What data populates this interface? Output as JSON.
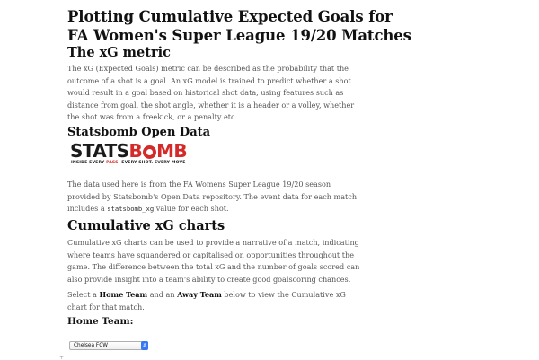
{
  "title": "Plotting Cumulative Expected Goals for FA Women's Super League 19/20 Matches",
  "title_line1": "Plotting Cumulative Expected Goals for",
  "title_line2": "FA Women's Super League 19/20 Matches",
  "sections": {
    "xg": {
      "heading": "The xG metric",
      "paragraph": "The xG (Expected Goals) metric can be described as the probability that the outcome of a shot is a goal. An xG model is trained to predict whether a shot would result in a goal based on historical shot data, using features such as distance from goal, the shot angle, whether it is a header or a volley, whether the shot was from a freekick, or a penalty etc."
    },
    "statsbomb": {
      "heading": "Statsbomb Open Data",
      "logo": {
        "word_stats": "STATS",
        "word_b": "B",
        "word_mb": "MB",
        "tagline_1": "INSIDE EVERY ",
        "tagline_2": "PASS",
        "tagline_3": ". EVERY SHOT. EVERY MOVE"
      },
      "paragraph_before_code": "The data used here is from the FA Womens Super League 19/20 season provided by Statsbomb's Open Data repository. The event data for each match includes a ",
      "code": "statsbomb_xg",
      "paragraph_after_code": " value for each shot."
    },
    "charts": {
      "heading": "Cumulative xG charts",
      "paragraph": "Cumulative xG charts can be used to provide a narrative of a match, indicating where teams have squandered or capitalised on opportunities throughout the game. The difference between the total xG and the number of goals scored can also provide insight into a team's ability to create good goalscoring chances.",
      "instruction_1": "Select a ",
      "home_team_bold": "Home Team",
      "instruction_2": " and an ",
      "away_team_bold": "Away Team",
      "instruction_3": " below to view the Cumulative xG chart for that match."
    },
    "home": {
      "label": "Home Team:",
      "selected": "Chelsea FCW",
      "arrow_icon": "up-down-chevron-icon"
    }
  },
  "colors": {
    "brand_red": "#d42a2a",
    "select_accent": "#3478f6",
    "text": "#555555",
    "heading": "#111111"
  }
}
